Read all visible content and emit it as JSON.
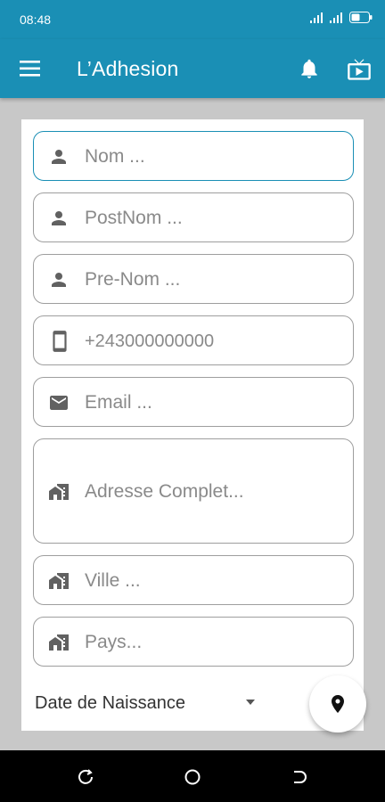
{
  "status_bar": {
    "time": "08:48"
  },
  "app_bar": {
    "title": "L’Adhesion",
    "menu_icon": "menu-icon",
    "bell_icon": "bell-icon",
    "tv_icon": "tv-icon"
  },
  "form": {
    "nom": {
      "placeholder": "Nom ...",
      "icon": "person-icon"
    },
    "postnom": {
      "placeholder": "PostNom ...",
      "icon": "person-icon"
    },
    "prenom": {
      "placeholder": "Pre-Nom ...",
      "icon": "person-icon"
    },
    "phone": {
      "placeholder": "+243000000000",
      "icon": "smartphone-icon"
    },
    "email": {
      "placeholder": "Email ...",
      "icon": "email-icon"
    },
    "adresse": {
      "placeholder": "Adresse Complet...",
      "icon": "home-work-icon"
    },
    "ville": {
      "placeholder": "Ville ...",
      "icon": "home-work-icon"
    },
    "pays": {
      "placeholder": "Pays...",
      "icon": "home-work-icon"
    },
    "date_naissance": {
      "label": "Date de Naissance",
      "icon": "arrow-drop-down-icon"
    }
  },
  "fab": {
    "icon": "location-pin-icon"
  },
  "colors": {
    "primary": "#1a8fb5",
    "icon_gray": "#616161",
    "placeholder": "#8a8a8a"
  }
}
